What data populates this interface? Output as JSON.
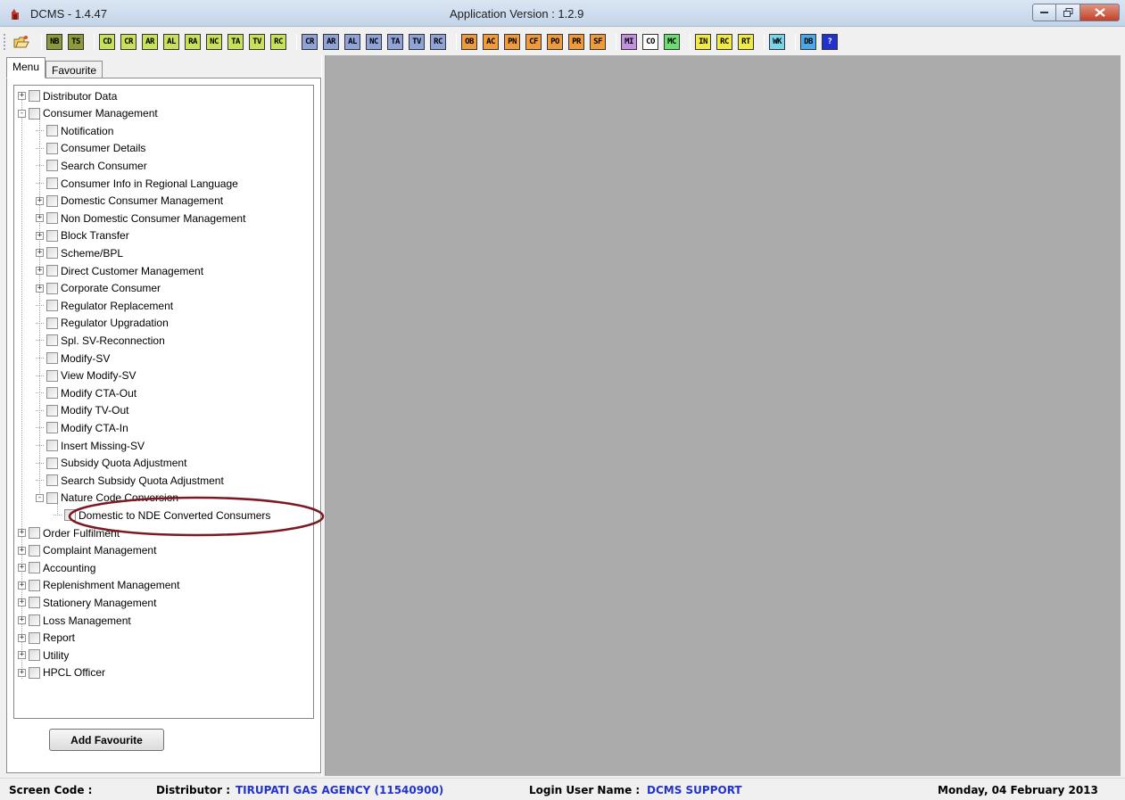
{
  "window": {
    "title": "DCMS - 1.4.47",
    "app_version": "Application Version : 1.2.9",
    "controls": {
      "minimize": "minimize-icon",
      "maximize": "maximize-icon",
      "close": "close-icon"
    }
  },
  "toolbar": {
    "groups": [
      [
        {
          "label": "NB",
          "color": "#8e9a3a"
        },
        {
          "label": "TS",
          "color": "#8e9a3a"
        }
      ],
      [
        {
          "label": "CD",
          "color": "#c8e15a"
        },
        {
          "label": "CR",
          "color": "#c8e15a"
        },
        {
          "label": "AR",
          "color": "#c8e15a"
        },
        {
          "label": "AL",
          "color": "#c8e15a"
        },
        {
          "label": "RA",
          "color": "#c8e15a"
        },
        {
          "label": "NC",
          "color": "#c8e15a"
        },
        {
          "label": "TA",
          "color": "#c8e15a"
        },
        {
          "label": "TV",
          "color": "#c8e15a"
        },
        {
          "label": "RC",
          "color": "#c8e15a"
        }
      ],
      [
        {
          "label": "CR",
          "color": "#8fa3d8"
        },
        {
          "label": "AR",
          "color": "#8fa3d8"
        },
        {
          "label": "AL",
          "color": "#8fa3d8"
        },
        {
          "label": "NC",
          "color": "#8fa3d8"
        },
        {
          "label": "TA",
          "color": "#8fa3d8"
        },
        {
          "label": "TV",
          "color": "#8fa3d8"
        },
        {
          "label": "RC",
          "color": "#8fa3d8"
        }
      ],
      [
        {
          "label": "OB",
          "color": "#ef9a3c"
        },
        {
          "label": "AC",
          "color": "#ef9a3c"
        },
        {
          "label": "PN",
          "color": "#ef9a3c"
        },
        {
          "label": "CF",
          "color": "#ef9a3c"
        },
        {
          "label": "PO",
          "color": "#ef9a3c"
        },
        {
          "label": "PR",
          "color": "#ef9a3c"
        },
        {
          "label": "SF",
          "color": "#ef9a3c"
        }
      ],
      [
        {
          "label": "MI",
          "color": "#c391e0"
        },
        {
          "label": "CO",
          "color": "#ffffff"
        },
        {
          "label": "MC",
          "color": "#6bdd72"
        }
      ],
      [
        {
          "label": "IN",
          "color": "#f0ea48"
        },
        {
          "label": "RC",
          "color": "#f0ea48"
        },
        {
          "label": "RT",
          "color": "#f0ea48"
        }
      ],
      [
        {
          "label": "WK",
          "color": "#79d4ec"
        }
      ],
      [
        {
          "label": "DB",
          "color": "#4ca8e6"
        },
        {
          "label": "?",
          "color": "#2233cc"
        }
      ]
    ]
  },
  "left_panel": {
    "tabs": [
      "Menu",
      "Favourite"
    ],
    "add_favourite_label": "Add Favourite",
    "tree": [
      {
        "label": "Distributor Data",
        "level": 0,
        "expander": "+"
      },
      {
        "label": "Consumer Management",
        "level": 0,
        "expander": "-"
      },
      {
        "label": "Notification",
        "level": 1,
        "expander": ""
      },
      {
        "label": "Consumer Details",
        "level": 1,
        "expander": ""
      },
      {
        "label": "Search Consumer",
        "level": 1,
        "expander": ""
      },
      {
        "label": "Consumer Info in Regional Language",
        "level": 1,
        "expander": ""
      },
      {
        "label": "Domestic Consumer Management",
        "level": 1,
        "expander": "+"
      },
      {
        "label": "Non Domestic Consumer Management",
        "level": 1,
        "expander": "+"
      },
      {
        "label": "Block Transfer",
        "level": 1,
        "expander": "+"
      },
      {
        "label": "Scheme/BPL",
        "level": 1,
        "expander": "+"
      },
      {
        "label": "Direct Customer Management",
        "level": 1,
        "expander": "+"
      },
      {
        "label": "Corporate Consumer",
        "level": 1,
        "expander": "+"
      },
      {
        "label": "Regulator Replacement",
        "level": 1,
        "expander": ""
      },
      {
        "label": "Regulator Upgradation",
        "level": 1,
        "expander": ""
      },
      {
        "label": "Spl. SV-Reconnection",
        "level": 1,
        "expander": ""
      },
      {
        "label": "Modify-SV",
        "level": 1,
        "expander": ""
      },
      {
        "label": "View Modify-SV",
        "level": 1,
        "expander": ""
      },
      {
        "label": "Modify CTA-Out",
        "level": 1,
        "expander": ""
      },
      {
        "label": "Modify TV-Out",
        "level": 1,
        "expander": ""
      },
      {
        "label": "Modify CTA-In",
        "level": 1,
        "expander": ""
      },
      {
        "label": "Insert Missing-SV",
        "level": 1,
        "expander": ""
      },
      {
        "label": "Subsidy Quota Adjustment",
        "level": 1,
        "expander": ""
      },
      {
        "label": "Search Subsidy Quota Adjustment",
        "level": 1,
        "expander": ""
      },
      {
        "label": "Nature Code Conversion",
        "level": 1,
        "expander": "-"
      },
      {
        "label": "Domestic to NDE Converted Consumers",
        "level": 2,
        "expander": ""
      },
      {
        "label": "Order Fulfilment",
        "level": 0,
        "expander": "+"
      },
      {
        "label": "Complaint Management",
        "level": 0,
        "expander": "+"
      },
      {
        "label": "Accounting",
        "level": 0,
        "expander": "+"
      },
      {
        "label": "Replenishment Management",
        "level": 0,
        "expander": "+"
      },
      {
        "label": "Stationery Management",
        "level": 0,
        "expander": "+"
      },
      {
        "label": "Loss Management",
        "level": 0,
        "expander": "+"
      },
      {
        "label": "Report",
        "level": 0,
        "expander": "+"
      },
      {
        "label": "Utility",
        "level": 0,
        "expander": "+"
      },
      {
        "label": "HPCL Officer",
        "level": 0,
        "expander": "+"
      }
    ]
  },
  "status_bar": {
    "screen_code_label": "Screen Code :",
    "distributor_label": "Distributor :",
    "distributor_value": "TIRUPATI GAS AGENCY (11540900)",
    "login_label": "Login User Name :",
    "login_value": "DCMS SUPPORT",
    "date": "Monday, 04 February 2013"
  },
  "colors": {
    "workspace_bg": "#ababab",
    "highlight_ellipse": "#7a1a24",
    "status_value": "#2233cc"
  }
}
